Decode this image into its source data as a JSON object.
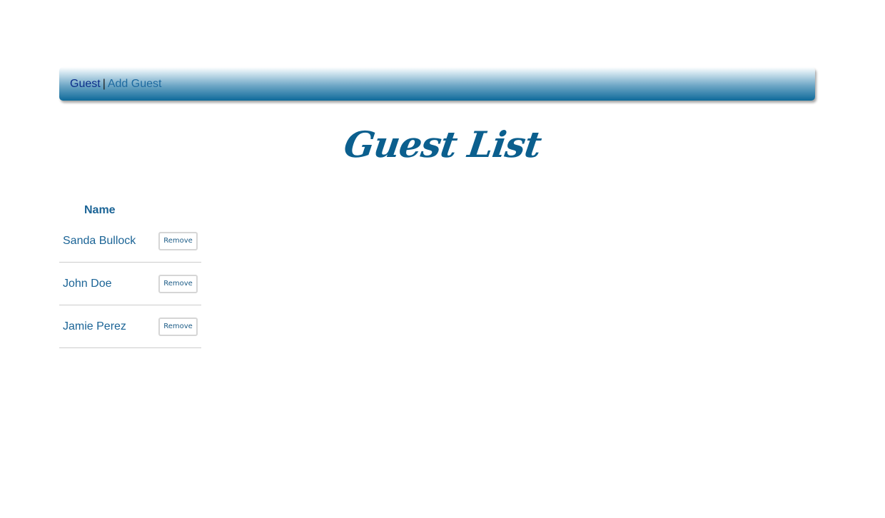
{
  "nav": {
    "guest_label": "Guest",
    "separator": "|",
    "add_guest_label": "Add Guest"
  },
  "page": {
    "title": "Guest List"
  },
  "table": {
    "headers": {
      "name": "Name"
    },
    "rows": [
      {
        "name": "Sanda Bullock",
        "action": "Remove"
      },
      {
        "name": "John Doe",
        "action": "Remove"
      },
      {
        "name": "Jamie Perez",
        "action": "Remove"
      }
    ]
  },
  "colors": {
    "accent": "#0b5f8e",
    "text_blue": "#1b6496",
    "active_link": "#0b2e8a",
    "row_border": "#cccccc"
  }
}
